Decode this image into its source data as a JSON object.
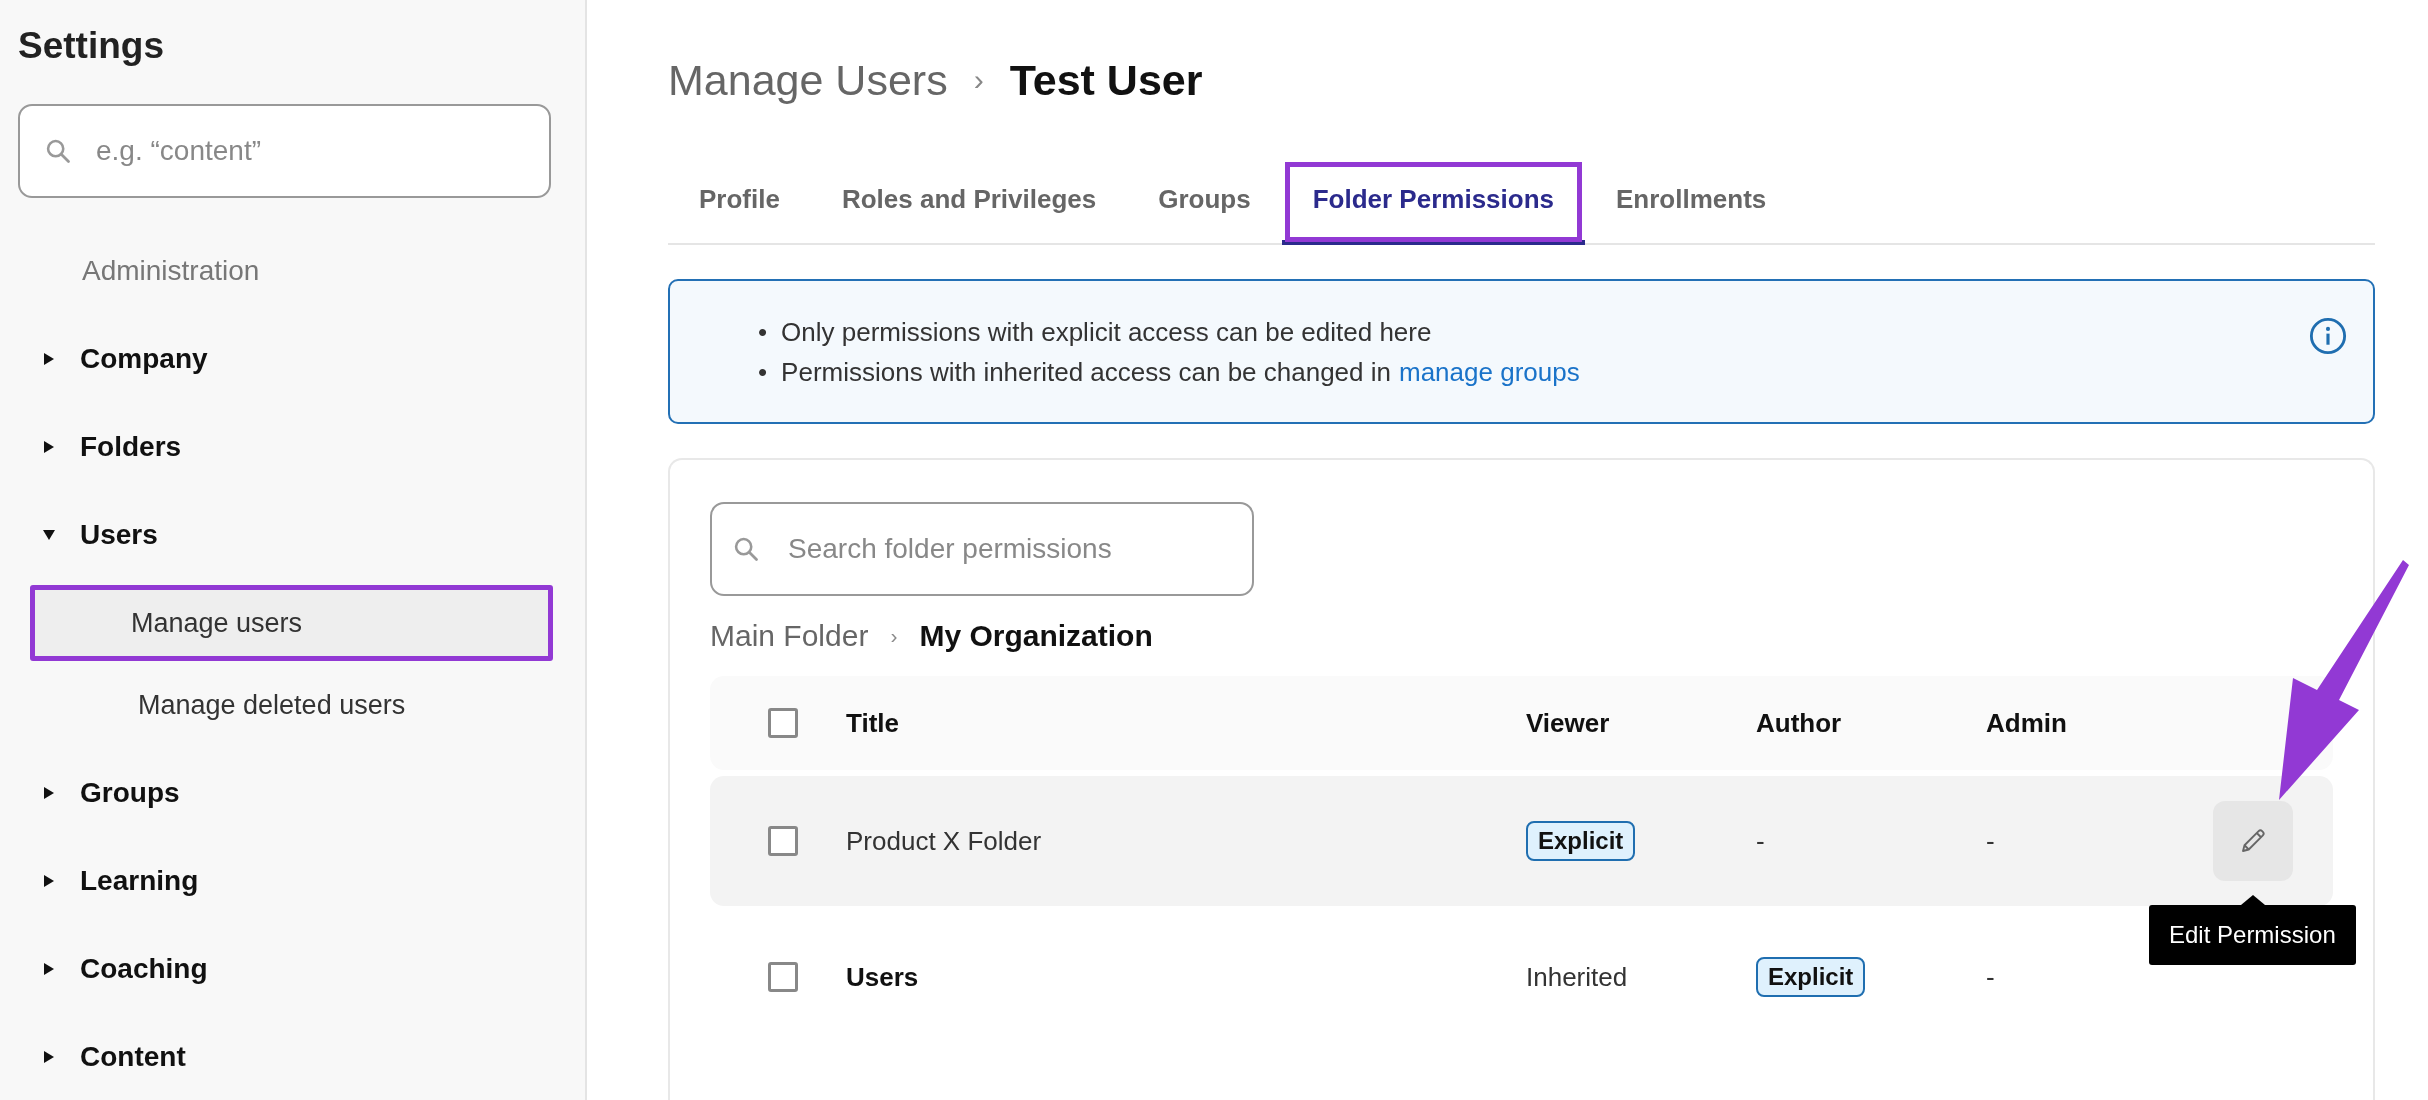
{
  "sidebar": {
    "title": "Settings",
    "search": {
      "placeholder": "e.g. “content”"
    },
    "items": [
      {
        "kind": "heading",
        "label": "Administration"
      },
      {
        "kind": "group",
        "label": "Company",
        "expanded": false
      },
      {
        "kind": "group",
        "label": "Folders",
        "expanded": false
      },
      {
        "kind": "group",
        "label": "Users",
        "expanded": true,
        "children": [
          {
            "label": "Manage users",
            "selected": true,
            "highlighted": true
          },
          {
            "label": "Manage deleted users",
            "selected": false,
            "highlighted": false
          }
        ]
      },
      {
        "kind": "group",
        "label": "Groups",
        "expanded": false
      },
      {
        "kind": "group",
        "label": "Learning",
        "expanded": false
      },
      {
        "kind": "group",
        "label": "Coaching",
        "expanded": false
      },
      {
        "kind": "group",
        "label": "Content",
        "expanded": false
      }
    ]
  },
  "breadcrumb": {
    "parent": "Manage Users",
    "separator": "›",
    "current": "Test User"
  },
  "tabs": [
    {
      "label": "Profile",
      "selected": false,
      "highlighted": false
    },
    {
      "label": "Roles and Privileges",
      "selected": false,
      "highlighted": false
    },
    {
      "label": "Groups",
      "selected": false,
      "highlighted": false
    },
    {
      "label": "Folder Permissions",
      "selected": true,
      "highlighted": true
    },
    {
      "label": "Enrollments",
      "selected": false,
      "highlighted": false
    }
  ],
  "info": {
    "bullets": [
      {
        "marker": "•",
        "text": "Only permissions with explicit access can be edited here"
      },
      {
        "marker": "•",
        "text": "Permissions with inherited access can be changed in",
        "link": "manage groups"
      }
    ]
  },
  "panel": {
    "search": {
      "placeholder": "Search folder permissions"
    },
    "folder_path": {
      "parent": "Main Folder",
      "separator": "›",
      "current": "My Organization"
    },
    "table": {
      "columns": [
        "Title",
        "Viewer",
        "Author",
        "Admin"
      ],
      "header_checked": false,
      "rows": [
        {
          "checked": false,
          "highlighted": true,
          "cells": [
            {
              "kind": "text",
              "text": "Product X Folder",
              "bold": false
            },
            {
              "kind": "badge",
              "text": "Explicit"
            },
            {
              "kind": "text",
              "text": "-",
              "bold": false
            },
            {
              "kind": "text",
              "text": "-",
              "bold": false
            }
          ],
          "edit_tooltip": "Edit Permission"
        },
        {
          "checked": false,
          "highlighted": false,
          "cells": [
            {
              "kind": "text",
              "text": "Users",
              "bold": true
            },
            {
              "kind": "text",
              "text": "Inherited",
              "bold": false
            },
            {
              "kind": "badge",
              "text": "Explicit"
            },
            {
              "kind": "text",
              "text": "-",
              "bold": false
            }
          ]
        }
      ]
    }
  },
  "annotations": [
    {
      "kind": "arrow"
    }
  ]
}
